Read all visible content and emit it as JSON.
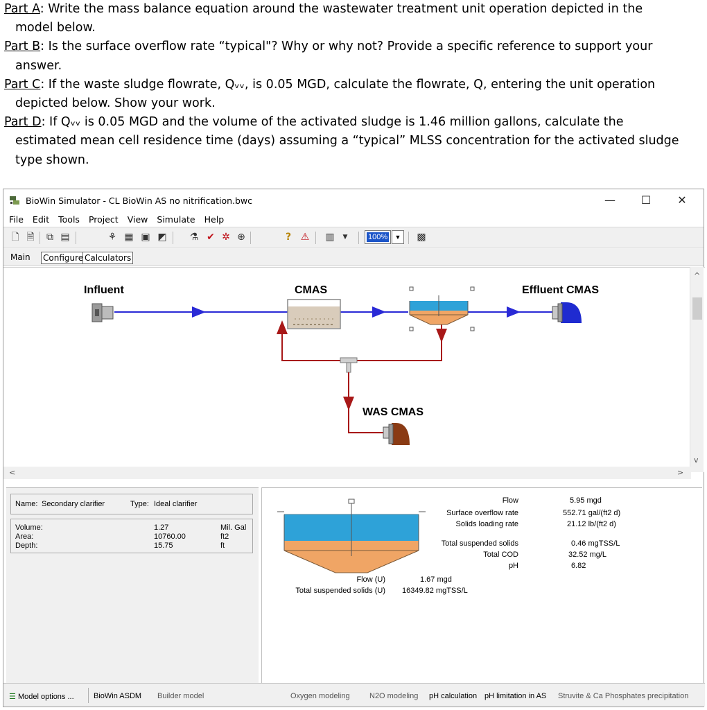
{
  "question": {
    "part_a_label": "Part A",
    "part_a_text_1": ": Write the mass balance equation around the wastewater treatment unit operation depicted in the",
    "part_a_text_2": "model below.",
    "part_b_label": "Part B",
    "part_b_text_1": ": Is the surface overflow rate “typical\"? Why or why not? Provide a specific reference to support your",
    "part_b_text_2": "answer.",
    "part_c_label": "Part C",
    "part_c_text_1": ": If the waste sludge flowrate, Qᵥᵥ, is 0.05 MGD, calculate the flowrate, Q, entering the unit operation",
    "part_c_text_2": "depicted below. Show your work.",
    "part_d_label": "Part D",
    "part_d_text_1": ": If Qᵥᵥ is 0.05 MGD and the volume of the activated sludge is 1.46 million gallons, calculate the",
    "part_d_text_2": "estimated mean cell residence time (days) assuming a “typical” MLSS concentration for the activated sludge",
    "part_d_text_3": "type shown."
  },
  "window": {
    "title": "BioWin Simulator - CL BioWin AS no nitrification.bwc",
    "minimize": "—",
    "maximize": "☐",
    "close": "✕"
  },
  "menu": [
    "File",
    "Edit",
    "Tools",
    "Project",
    "View",
    "Simulate",
    "Help"
  ],
  "toolbar": {
    "zoom": "100%",
    "icons": [
      "new-file-icon",
      "open-file-icon",
      "copy-icon",
      "print-icon",
      "sweep-icon",
      "grid-icon",
      "table-icon",
      "chart-icon",
      "plant-icon",
      "check-icon",
      "settings-icon",
      "target-icon",
      "help-icon",
      "warning-icon",
      "bin-icon",
      "dropdown-icon",
      "calc-icon"
    ]
  },
  "tabs": {
    "main": "Main",
    "configure": "Configure",
    "calculators": "Calculators"
  },
  "flowsheet": {
    "influent_label": "Influent",
    "cmas_label": "CMAS",
    "effluent_label": "Effluent CMAS",
    "was_label": "WAS CMAS",
    "colors": {
      "flow_line": "#2a2ad6",
      "recycle_line": "#a81818",
      "tank_fill": "#d9ccbb",
      "clarifier_water": "#2ea2d8",
      "clarifier_sludge": "#f0a565",
      "effluent_blue": "#1f2bd0",
      "was_brown": "#8a3b14"
    }
  },
  "unit": {
    "name_label": "Name:",
    "name_value": "Secondary clarifier",
    "type_label": "Type:",
    "type_value": "Ideal clarifier",
    "volume_label": "Volume:",
    "volume_value": "1.27",
    "volume_unit": "Mil. Gal",
    "area_label": "Area:",
    "area_value": "10760.00",
    "area_unit": "ft2",
    "depth_label": "Depth:",
    "depth_value": "15.75",
    "depth_unit": "ft"
  },
  "results": {
    "flow_label": "Flow",
    "flow_value": "5.95 mgd",
    "sor_label": "Surface overflow rate",
    "sor_value": "552.71 gal/(ft2 d)",
    "slr_label": "Solids loading rate",
    "slr_value": "21.12 lb/(ft2 d)",
    "tss_label": "Total suspended solids",
    "tss_value": "0.46 mgTSS/L",
    "cod_label": "Total COD",
    "cod_value": "32.52 mg/L",
    "ph_label": "pH",
    "ph_value": "6.82",
    "underflow_flow_label": "Flow (U)",
    "underflow_flow_value": "1.67 mgd",
    "underflow_tss_label": "Total suspended solids (U)",
    "underflow_tss_value": "16349.82 mgTSS/L"
  },
  "status": {
    "model_options": "Model options ...",
    "model": "BioWin ASDM",
    "builder": "Builder model",
    "oxygen": "Oxygen modeling",
    "n2o": "N2O modeling",
    "ph_calc": "pH calculation",
    "ph_limit": "pH limitation in AS",
    "struvite": "Struvite & Ca Phosphates precipitation"
  }
}
